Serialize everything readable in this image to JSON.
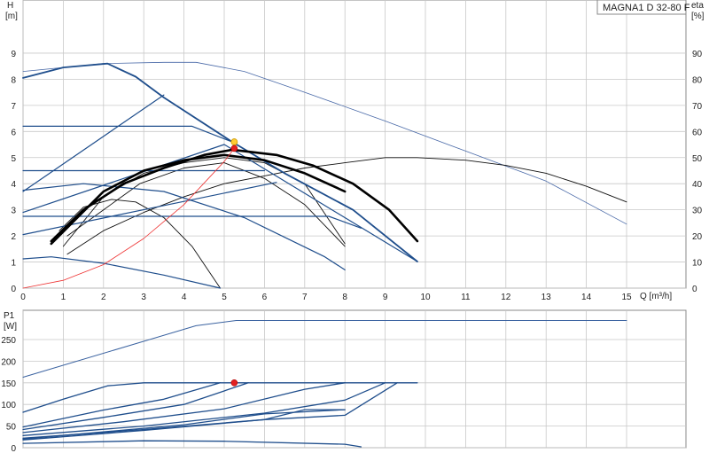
{
  "chart_data": [
    {
      "type": "line",
      "title": "MAGNA1 D 32-80 F",
      "xlabel": "Q [m³/h]",
      "ylabel": [
        "H",
        "[m]"
      ],
      "y2label": [
        "eta",
        "[%]"
      ],
      "xlim": [
        0,
        15
      ],
      "ylim": [
        0,
        9
      ],
      "y2lim": [
        0,
        90
      ],
      "x_ticks": [
        "0",
        "1",
        "2",
        "3",
        "4",
        "5",
        "6",
        "7",
        "8",
        "9",
        "10",
        "11",
        "12",
        "13",
        "14",
        "15"
      ],
      "y_ticks": [
        "0",
        "1",
        "2",
        "3",
        "4",
        "5",
        "6",
        "7",
        "8",
        "9"
      ],
      "y2_ticks": [
        "0",
        "10",
        "20",
        "30",
        "40",
        "50",
        "60",
        "70",
        "80",
        "90"
      ],
      "grid": true,
      "series_head_max": [
        [
          0,
          8.05
        ],
        [
          1,
          8.45
        ],
        [
          2.1,
          8.6
        ],
        [
          2.8,
          8.1
        ],
        [
          3.5,
          7.3
        ],
        [
          5.2,
          5.6
        ],
        [
          6.5,
          4.4
        ],
        [
          8.2,
          3.0
        ],
        [
          9.8,
          1.02
        ]
      ],
      "series_head_constant": [
        [
          [
            0,
            6.2
          ],
          [
            4.2,
            6.2
          ],
          [
            5.2,
            5.6
          ]
        ],
        [
          [
            0,
            4.5
          ],
          [
            6.0,
            4.5
          ]
        ],
        [
          [
            0,
            2.75
          ],
          [
            7.6,
            2.75
          ],
          [
            8.4,
            2.3
          ]
        ]
      ],
      "series_head_proportional": [
        [
          [
            0,
            3.7
          ],
          [
            3.5,
            7.4
          ]
        ],
        [
          [
            0,
            2.9
          ],
          [
            5.0,
            5.5
          ],
          [
            9.8,
            1.02
          ]
        ],
        [
          [
            0,
            2.05
          ],
          [
            6.3,
            4.05
          ]
        ],
        [
          [
            0,
            1.12
          ],
          [
            0.7,
            1.2
          ],
          [
            2.0,
            0.95
          ],
          [
            3.5,
            0.5
          ],
          [
            4.9,
            0.0
          ]
        ],
        [
          [
            0,
            3.75
          ],
          [
            1.5,
            4.0
          ],
          [
            3.5,
            3.7
          ],
          [
            5.5,
            2.7
          ],
          [
            7.5,
            1.2
          ],
          [
            8.0,
            0.7
          ]
        ]
      ],
      "series_efficiency_bold": [
        [
          [
            0.7,
            18
          ],
          [
            1.5,
            30
          ],
          [
            2.5,
            40
          ],
          [
            3.5,
            46
          ],
          [
            4.5,
            51
          ],
          [
            5.2,
            53
          ],
          [
            6.3,
            51
          ],
          [
            7.2,
            47
          ],
          [
            8.2,
            40
          ],
          [
            9.1,
            30
          ],
          [
            9.8,
            18
          ]
        ],
        [
          [
            0.7,
            17
          ],
          [
            2,
            37
          ],
          [
            3,
            45
          ],
          [
            4,
            49
          ],
          [
            5,
            51
          ],
          [
            6,
            49
          ],
          [
            7,
            44
          ],
          [
            8,
            37
          ]
        ]
      ],
      "series_efficiency_thin": [
        [
          [
            1,
            16
          ],
          [
            2,
            35
          ],
          [
            3,
            44
          ],
          [
            4,
            48
          ],
          [
            5,
            50
          ],
          [
            6,
            48
          ],
          [
            7,
            40
          ],
          [
            8,
            17
          ]
        ],
        [
          [
            1.1,
            20
          ],
          [
            2,
            30
          ],
          [
            2.9,
            40
          ],
          [
            4,
            46
          ],
          [
            5,
            48
          ],
          [
            6,
            42
          ],
          [
            7,
            32
          ],
          [
            8,
            16
          ]
        ],
        [
          [
            0.9,
            22
          ],
          [
            1.5,
            31
          ],
          [
            2.2,
            34
          ],
          [
            2.8,
            33
          ],
          [
            3.5,
            27
          ],
          [
            4.2,
            16
          ],
          [
            4.9,
            0
          ]
        ],
        [
          [
            1.1,
            13
          ],
          [
            2,
            22
          ],
          [
            3,
            29
          ],
          [
            4,
            35
          ],
          [
            5,
            40
          ],
          [
            6,
            43
          ],
          [
            7,
            46
          ],
          [
            8,
            48
          ],
          [
            9,
            50
          ],
          [
            9.8,
            50
          ],
          [
            11,
            49
          ],
          [
            12,
            47
          ],
          [
            13,
            44
          ],
          [
            14,
            39
          ],
          [
            15,
            33
          ]
        ]
      ],
      "series_eta_max": [
        [
          0,
          83
        ],
        [
          2,
          86
        ],
        [
          3.5,
          86.5
        ],
        [
          4.3,
          86.5
        ],
        [
          5.5,
          83
        ],
        [
          7,
          75
        ],
        [
          9,
          64
        ],
        [
          11,
          52.5
        ],
        [
          13,
          41
        ],
        [
          15,
          24.5
        ]
      ],
      "series_system_curve": [
        [
          0,
          0
        ],
        [
          1,
          0.3
        ],
        [
          2,
          0.9
        ],
        [
          3,
          1.9
        ],
        [
          4,
          3.2
        ],
        [
          5,
          4.85
        ],
        [
          5.25,
          5.35
        ]
      ],
      "duty_point": {
        "q": 5.25,
        "h": 5.35,
        "eta": 56
      }
    },
    {
      "type": "line",
      "xlabel": "",
      "ylabel": [
        "P1",
        "[W]"
      ],
      "xlim": [
        0,
        15
      ],
      "ylim": [
        0,
        300
      ],
      "y_ticks": [
        "0",
        "50",
        "100",
        "150",
        "200",
        "250"
      ],
      "grid": true,
      "series_power": [
        [
          [
            0,
            163
          ],
          [
            4.3,
            282
          ],
          [
            5.3,
            294
          ],
          [
            15,
            294
          ]
        ],
        [
          [
            0,
            82
          ],
          [
            1,
            112
          ],
          [
            2.1,
            143
          ],
          [
            3,
            150
          ],
          [
            9.8,
            150
          ]
        ],
        [
          [
            0,
            48
          ],
          [
            2,
            87
          ],
          [
            3.5,
            112
          ],
          [
            4.9,
            150
          ]
        ],
        [
          [
            0,
            42
          ],
          [
            2,
            70
          ],
          [
            4,
            100
          ],
          [
            5.6,
            150
          ]
        ],
        [
          [
            0,
            35
          ],
          [
            2.5,
            60
          ],
          [
            5,
            90
          ],
          [
            7,
            135
          ],
          [
            8,
            150
          ]
        ],
        [
          [
            0,
            28
          ],
          [
            3,
            50
          ],
          [
            6,
            80
          ],
          [
            8,
            110
          ],
          [
            9,
            150
          ]
        ],
        [
          [
            0,
            22
          ],
          [
            3,
            42
          ],
          [
            6,
            65
          ],
          [
            8,
            75
          ],
          [
            9.3,
            150
          ]
        ],
        [
          [
            0,
            20
          ],
          [
            4,
            53
          ],
          [
            6,
            78
          ],
          [
            8,
            88
          ]
        ],
        [
          [
            0,
            18
          ],
          [
            3,
            40
          ],
          [
            6,
            65
          ],
          [
            7,
            88
          ],
          [
            8,
            88
          ]
        ],
        [
          [
            0,
            10
          ],
          [
            3,
            16
          ],
          [
            5,
            15
          ],
          [
            8,
            8
          ],
          [
            8.4,
            2
          ]
        ]
      ],
      "duty_point": {
        "q": 5.25,
        "p1": 150
      }
    }
  ]
}
